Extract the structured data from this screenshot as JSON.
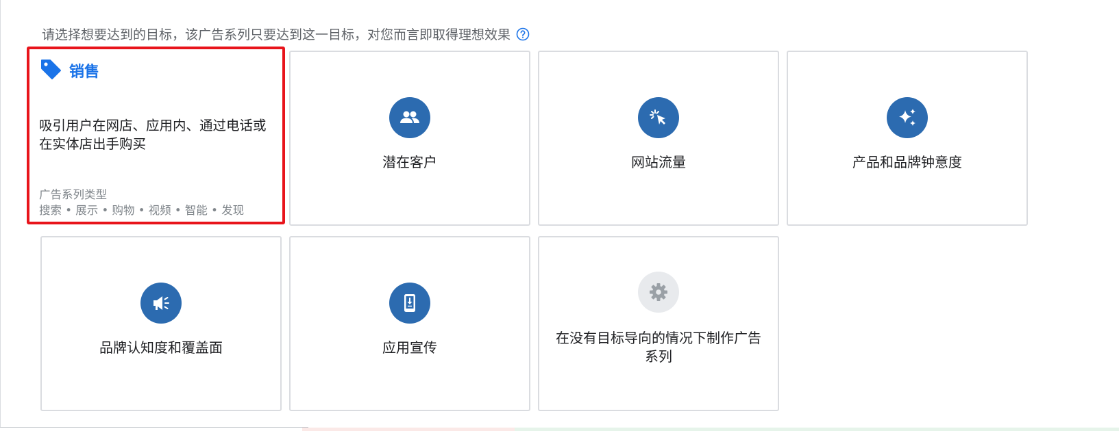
{
  "instruction": "请选择想要达到的目标，该广告系列只要达到这一目标，对您而言即取得理想效果",
  "colors": {
    "accent": "#1a73e8",
    "icon_circle": "#2c6bb0",
    "selected_border": "#e8141b"
  },
  "selected_card": {
    "title": "销售",
    "icon": "tag-icon",
    "description": "吸引用户在网店、应用内、通过电话或在实体店出手购买",
    "types_heading": "广告系列类型",
    "types": "搜索 • 展示 • 购物 • 视频 • 智能 • 发现"
  },
  "cards": [
    {
      "label": "潜在客户",
      "icon": "people-icon"
    },
    {
      "label": "网站流量",
      "icon": "cursor-click-icon"
    },
    {
      "label": "产品和品牌钟意度",
      "icon": "sparkle-icon"
    },
    {
      "label": "品牌认知度和覆盖面",
      "icon": "megaphone-icon"
    },
    {
      "label": "应用宣传",
      "icon": "phone-download-icon"
    },
    {
      "label": "在没有目标导向的情况下制作广告系列",
      "icon": "gear-icon"
    }
  ]
}
